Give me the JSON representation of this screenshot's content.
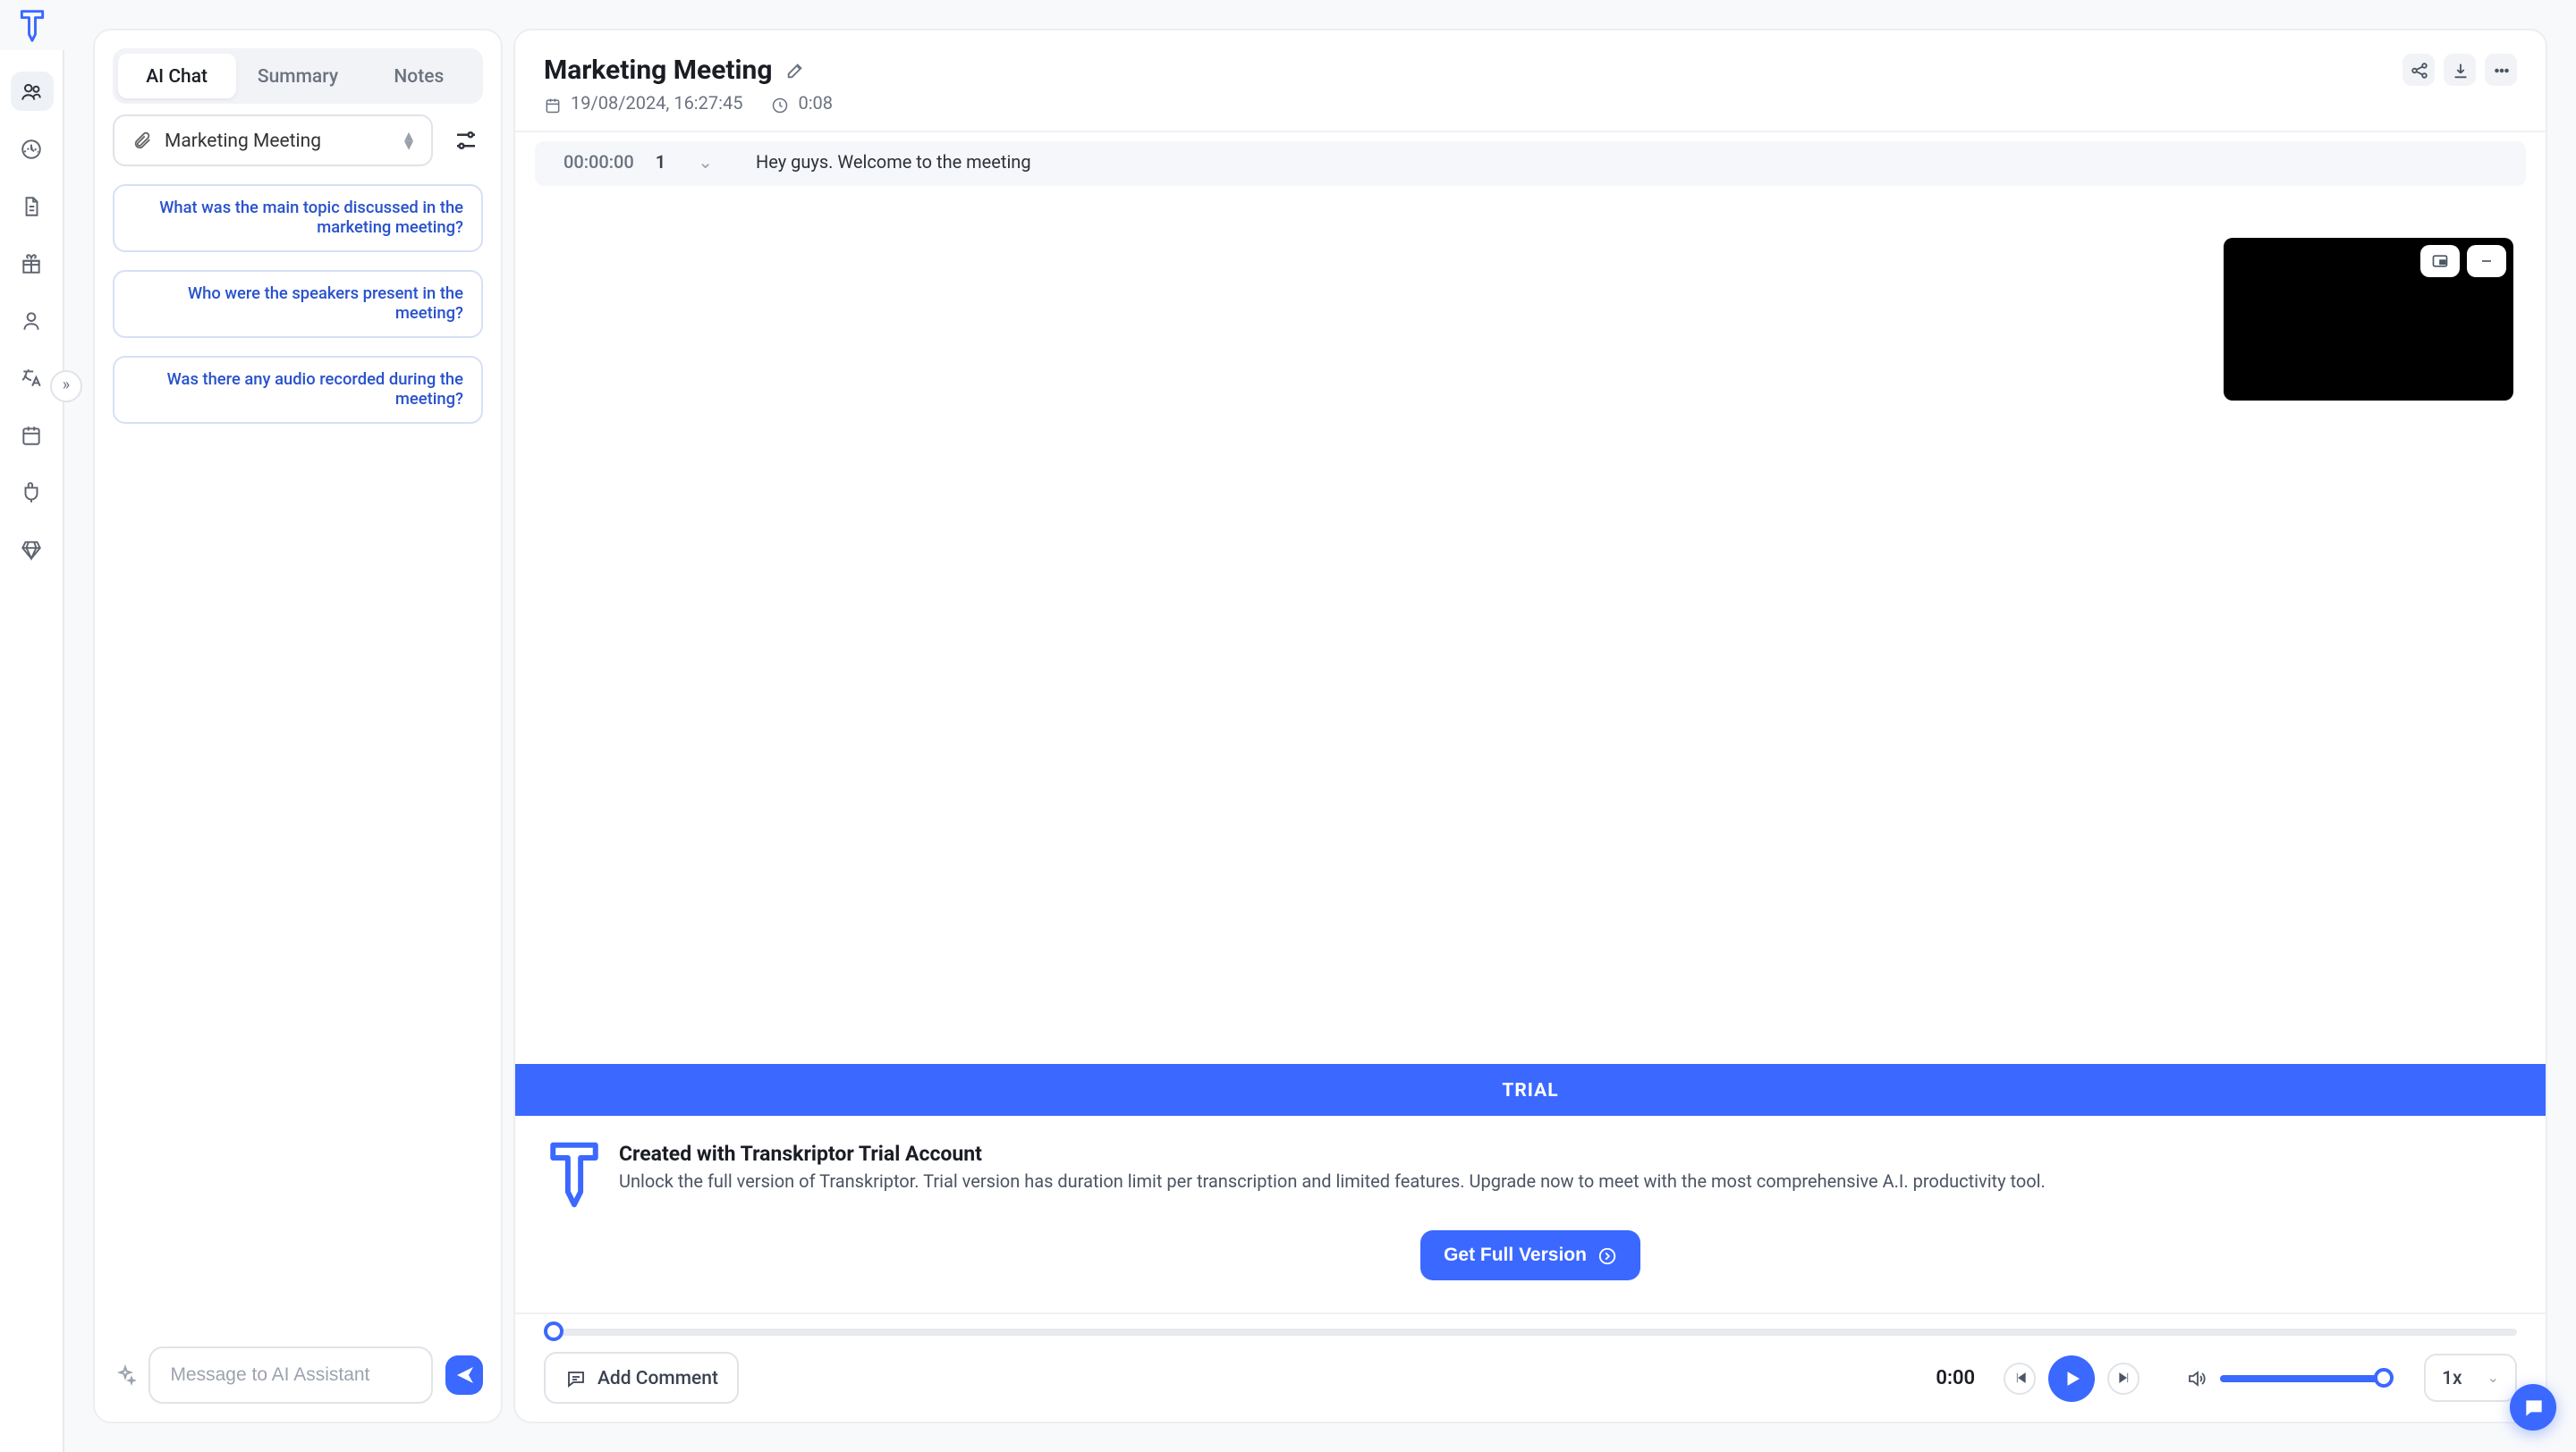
{
  "sidebar": {
    "items": [
      {
        "name": "team"
      },
      {
        "name": "dashboard"
      },
      {
        "name": "files"
      },
      {
        "name": "gift"
      },
      {
        "name": "user"
      },
      {
        "name": "language"
      },
      {
        "name": "calendar"
      },
      {
        "name": "integration"
      },
      {
        "name": "premium"
      }
    ]
  },
  "tabs": {
    "ai_chat": "AI Chat",
    "summary": "Summary",
    "notes": "Notes"
  },
  "source": {
    "label": "Marketing Meeting"
  },
  "suggestions": [
    "What was the main topic discussed in the marketing meeting?",
    "Who were the speakers present in the meeting?",
    "Was there any audio recorded during the meeting?"
  ],
  "chat": {
    "placeholder": "Message to AI Assistant"
  },
  "doc": {
    "title": "Marketing Meeting",
    "date": "19/08/2024, 16:27:45",
    "duration": "0:08"
  },
  "transcript": {
    "time": "00:00:00",
    "speaker": "1",
    "text": "Hey guys. Welcome to the meeting"
  },
  "trial": {
    "badge": "TRIAL",
    "heading": "Created with Transkriptor Trial Account",
    "body": "Unlock the full version of Transkriptor. Trial version has duration limit per transcription and limited features. Upgrade now to meet with the most comprehensive A.I. productivity tool.",
    "cta": "Get Full Version"
  },
  "player": {
    "time": "0:00",
    "comment": "Add Comment",
    "speed": "1x"
  }
}
